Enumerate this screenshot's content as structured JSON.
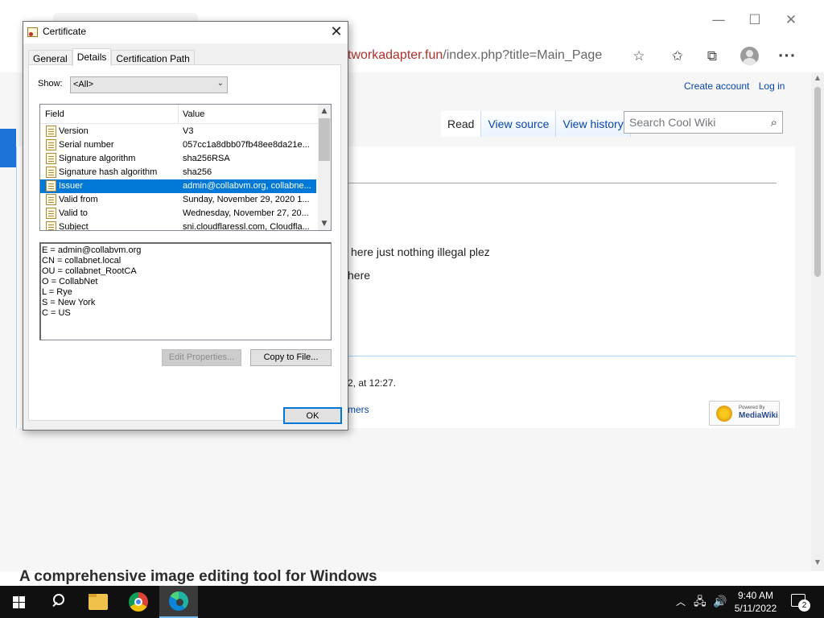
{
  "browser": {
    "window_controls": {
      "minimize": "—",
      "maximize": "☐",
      "close": "✕"
    },
    "address": {
      "url_domain": "tworkadapter.fun",
      "url_path": "/index.php?title=Main_Page"
    },
    "toolbar_icons": {
      "add_favorite": "☆",
      "favorites": "✩",
      "collections": "⧉",
      "menu": "···"
    }
  },
  "wiki": {
    "personal_tools": [
      "Create account",
      "Log in"
    ],
    "view_tabs": [
      {
        "label": "Read",
        "selected": true
      },
      {
        "label": "View source",
        "selected": false
      },
      {
        "label": "View history",
        "selected": false
      }
    ],
    "search_placeholder": "Search Cool Wiki",
    "search_icon": "⌕",
    "body_line_1": "here just nothing illegal plez",
    "body_line_2": "here",
    "footer_lastmod": "2, at 12:27.",
    "footer_link": "mers",
    "badge": {
      "powered_by": "Powered By",
      "name": "MediaWiki"
    }
  },
  "status_text": "A comprehensive image editing tool for Windows",
  "dialog": {
    "title": "Certificate",
    "close_glyph": "✕",
    "tabs": [
      {
        "label": "General",
        "active": false
      },
      {
        "label": "Details",
        "active": true
      },
      {
        "label": "Certification Path",
        "active": false
      }
    ],
    "show_label": "Show:",
    "show_value": "<All>",
    "columns": {
      "field": "Field",
      "value": "Value"
    },
    "rows": [
      {
        "field": "Version",
        "value": "V3",
        "selected": false
      },
      {
        "field": "Serial number",
        "value": "057cc1a8dbb07fb48ee8da21e...",
        "selected": false
      },
      {
        "field": "Signature algorithm",
        "value": "sha256RSA",
        "selected": false
      },
      {
        "field": "Signature hash algorithm",
        "value": "sha256",
        "selected": false
      },
      {
        "field": "Issuer",
        "value": "admin@collabvm.org, collabne...",
        "selected": true
      },
      {
        "field": "Valid from",
        "value": "Sunday, November 29, 2020 1...",
        "selected": false
      },
      {
        "field": "Valid to",
        "value": "Wednesday, November 27, 20...",
        "selected": false
      },
      {
        "field": "Subject",
        "value": "sni.cloudflaressl.com, Cloudfla...",
        "selected": false
      }
    ],
    "detail_lines": [
      "E = admin@collabvm.org",
      "CN = collabnet.local",
      "OU = collabnet_RootCA",
      "O = CollabNet",
      "L = Rye",
      "S = New York",
      "C = US"
    ],
    "edit_properties_label": "Edit Properties...",
    "copy_to_file_label": "Copy to File...",
    "ok_label": "OK"
  },
  "taskbar": {
    "time": "9:40 AM",
    "date": "5/11/2022",
    "notification_count": "2",
    "tray": {
      "chevron": "︿",
      "network": "🖧",
      "volume": "🔊"
    }
  }
}
